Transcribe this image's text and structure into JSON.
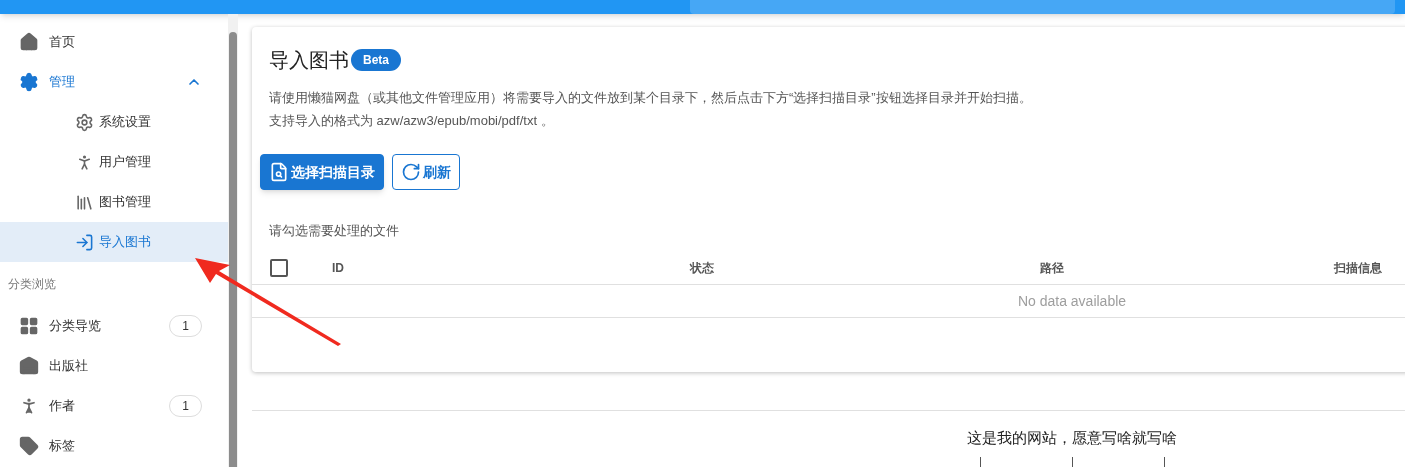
{
  "sidebar": {
    "items": [
      {
        "kind": "link",
        "label": "首页",
        "selected": false
      },
      {
        "kind": "group",
        "label": "管理",
        "expanded": true,
        "children": [
          {
            "label": "系统设置",
            "selected": false
          },
          {
            "label": "用户管理",
            "selected": false
          },
          {
            "label": "图书管理",
            "selected": false
          },
          {
            "label": "导入图书",
            "selected": true
          }
        ]
      },
      {
        "kind": "subheader",
        "label": "分类浏览"
      },
      {
        "kind": "link",
        "label": "分类导览",
        "count": "1",
        "selected": false
      },
      {
        "kind": "link",
        "label": "出版社",
        "selected": false
      },
      {
        "kind": "link",
        "label": "作者",
        "count": "1",
        "selected": false
      },
      {
        "kind": "link",
        "label": "标签",
        "selected": false
      }
    ]
  },
  "card": {
    "title": "导入图书",
    "badge": "Beta",
    "description": [
      "请使用懒猫网盘（或其他文件管理应用）将需要导入的文件放到某个目录下，然后点击下方“选择扫描目录”按钮选择目录并开始扫描。",
      "支持导入的格式为 azw/azw3/epub/mobi/pdf/txt 。"
    ],
    "buttons": [
      {
        "kind": "primary",
        "label": "选择扫描目录"
      },
      {
        "kind": "outlined",
        "label": "刷新"
      }
    ],
    "table_caption": "请勾选需要处理的文件",
    "table": {
      "select_all": {
        "checked": false
      },
      "columns": [
        "ID",
        "状态",
        "路径",
        "扫描信息"
      ],
      "empty_text": "No data available"
    }
  },
  "footer": {
    "text": "这是我的网站，愿意写啥就写啥"
  }
}
